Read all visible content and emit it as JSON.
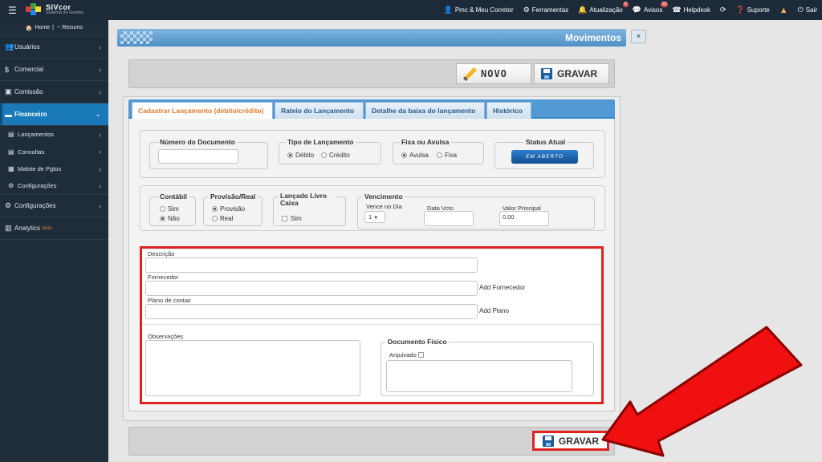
{
  "topbar": {
    "brand": "SIVcor",
    "brand_sub": "Sistema de Gestão",
    "nav": [
      {
        "label": "Pmc & Meu Corretor",
        "icon": "user-icon"
      },
      {
        "label": "Ferramentas",
        "icon": "gears-icon"
      },
      {
        "label": "Atualização",
        "icon": "bell-icon",
        "badge": "6"
      },
      {
        "label": "Avisos",
        "icon": "comments-icon",
        "badge": "25"
      },
      {
        "label": "Helpdesk",
        "icon": "headset-icon"
      },
      {
        "label": "",
        "icon": "refresh-icon"
      },
      {
        "label": "Suporte",
        "icon": "help-icon"
      },
      {
        "label": "",
        "icon": "warning-icon"
      },
      {
        "label": "Sair",
        "icon": "power-icon"
      }
    ]
  },
  "sidebar": {
    "home": "Home",
    "resumo": "Resumo",
    "items": [
      {
        "label": "Usuários",
        "icon": "users-icon"
      },
      {
        "label": "Comercial",
        "icon": "dollar-icon"
      },
      {
        "label": "Comissão",
        "icon": "money-icon"
      },
      {
        "label": "Financeiro",
        "icon": "card-icon"
      }
    ],
    "subitems": [
      {
        "label": "Lançamentos",
        "icon": "doc-icon"
      },
      {
        "label": "Consultas",
        "icon": "doc-icon"
      },
      {
        "label": "Malote de Pgtos",
        "icon": "grid-icon"
      },
      {
        "label": "Configurações",
        "icon": "gear-icon"
      }
    ],
    "bottom_items": [
      {
        "label": "Configurações",
        "icon": "gears-icon"
      },
      {
        "label": "Analytics",
        "icon": "chart-icon",
        "tag": "beta"
      }
    ]
  },
  "page": {
    "title": "Movimentos",
    "close": "×"
  },
  "toolbar": {
    "novo_label": "NOVO",
    "gravar_label": "GRAVAR"
  },
  "tabs": [
    "Cadastrar Lançamento (débito/crédito)",
    "Rateio do Lançamento",
    "Detalhe da baixa do lançamento",
    "Histórico"
  ],
  "form": {
    "numero_documento": {
      "legend": "Número do Documento",
      "value": ""
    },
    "tipo_lancamento": {
      "legend": "Tipo de Lançamento",
      "options": [
        "Débito",
        "Crédito"
      ],
      "selected": "Débito"
    },
    "fixa_avulsa": {
      "legend": "Fixa ou Avulsa",
      "options": [
        "Avulsa",
        "Fixa"
      ],
      "selected": "Avulsa"
    },
    "status_atual": {
      "legend": "Status Atual",
      "value": "EM ABERTO"
    },
    "contabil": {
      "legend": "Contábil",
      "options": [
        "Sim",
        "Não"
      ],
      "selected": "Não"
    },
    "provisao_real": {
      "legend": "Provisão/Real",
      "options": [
        "Provisão",
        "Real"
      ],
      "selected": "Provisão"
    },
    "lancado_livro_caixa": {
      "legend": "Lançado Livro Caixa",
      "option": "Sim",
      "checked": false
    },
    "vencimento": {
      "legend": "Vencimento",
      "vence_no_dia_label": "Vence no Dia",
      "vence_no_dia_value": "1",
      "data_vcto_label": "Data Vcto",
      "data_vcto_value": "",
      "valor_principal_label": "Valor Principal",
      "valor_principal_value": "0,00"
    },
    "descricao_label": "Descrição",
    "fornecedor_label": "Fornecedor",
    "add_fornecedor": "Add Fornecedor",
    "plano_contas_label": "Plano de contas",
    "add_plano": "Add Plano",
    "observacoes_label": "Observações",
    "documento_fisico": {
      "legend": "Documento Físico",
      "arquivado_label": "Arquivado",
      "checked": false
    }
  },
  "bottom": {
    "gravar_label": "GRAVAR"
  },
  "colors": {
    "accent": "#1a7ab9",
    "highlight": "#e02020",
    "sidebar_bg": "#1f2d3a",
    "active_tab_text": "#e0782c"
  }
}
